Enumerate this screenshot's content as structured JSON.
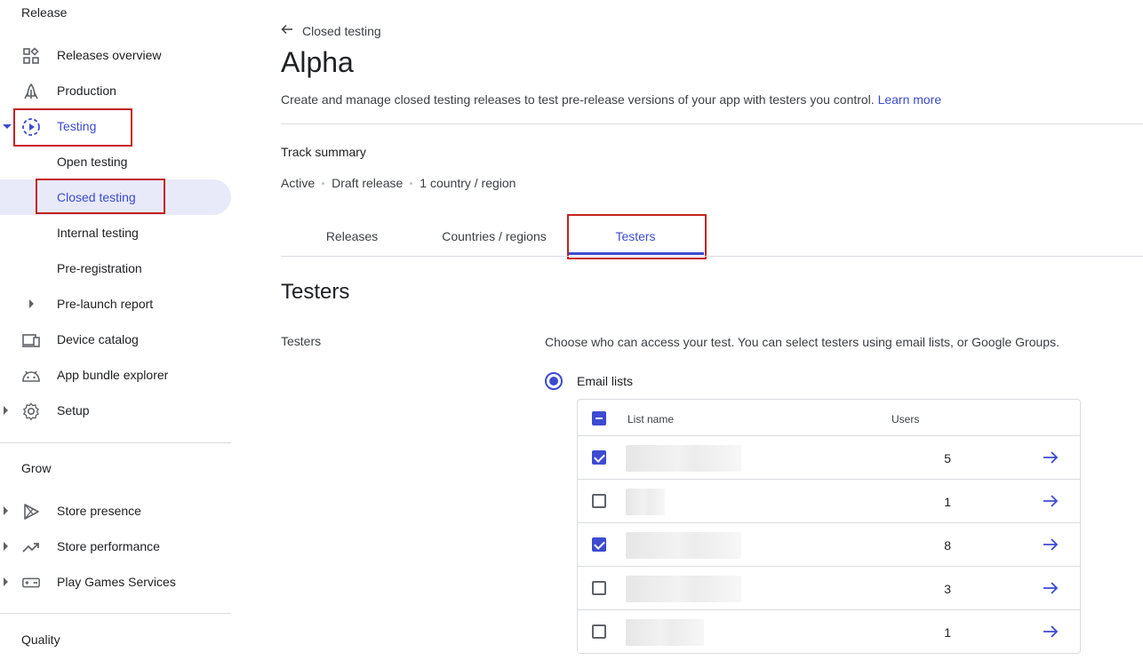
{
  "sidebar": {
    "release_title": "Release",
    "grow_title": "Grow",
    "quality_title": "Quality",
    "items": [
      {
        "label": "Releases overview",
        "icon": "dashboard-icon"
      },
      {
        "label": "Production",
        "icon": "rocket-icon"
      },
      {
        "label": "Testing",
        "icon": "testing-icon"
      },
      {
        "label": "Open testing"
      },
      {
        "label": "Closed testing"
      },
      {
        "label": "Internal testing"
      },
      {
        "label": "Pre-registration"
      },
      {
        "label": "Pre-launch report"
      },
      {
        "label": "Device catalog",
        "icon": "devices-icon"
      },
      {
        "label": "App bundle explorer",
        "icon": "android-icon"
      },
      {
        "label": "Setup",
        "icon": "gear-icon"
      }
    ],
    "grow_items": [
      {
        "label": "Store presence",
        "icon": "play-icon"
      },
      {
        "label": "Store performance",
        "icon": "trending-icon"
      },
      {
        "label": "Play Games Services",
        "icon": "gamepad-icon"
      }
    ]
  },
  "header": {
    "back_label": "Closed testing",
    "title": "Alpha",
    "description": "Create and manage closed testing releases to test pre-release versions of your app with testers you control.",
    "learn_more": "Learn more"
  },
  "track": {
    "title": "Track summary",
    "status": "Active",
    "release": "Draft release",
    "countries": "1 country / region"
  },
  "tabs": [
    "Releases",
    "Countries / regions",
    "Testers"
  ],
  "testers": {
    "heading": "Testers",
    "label": "Testers",
    "description": "Choose who can access your test. You can select testers using email lists, or Google Groups.",
    "option_label": "Email lists",
    "columns": {
      "name": "List name",
      "users": "Users"
    },
    "rows": [
      {
        "users": "5",
        "checked": true
      },
      {
        "users": "1",
        "checked": false
      },
      {
        "users": "8",
        "checked": true
      },
      {
        "users": "3",
        "checked": false
      },
      {
        "users": "1",
        "checked": false
      }
    ]
  },
  "colors": {
    "accent": "#3c4bd1",
    "highlight_box": "#c5221f",
    "selected_bg": "#e8eaf9"
  }
}
